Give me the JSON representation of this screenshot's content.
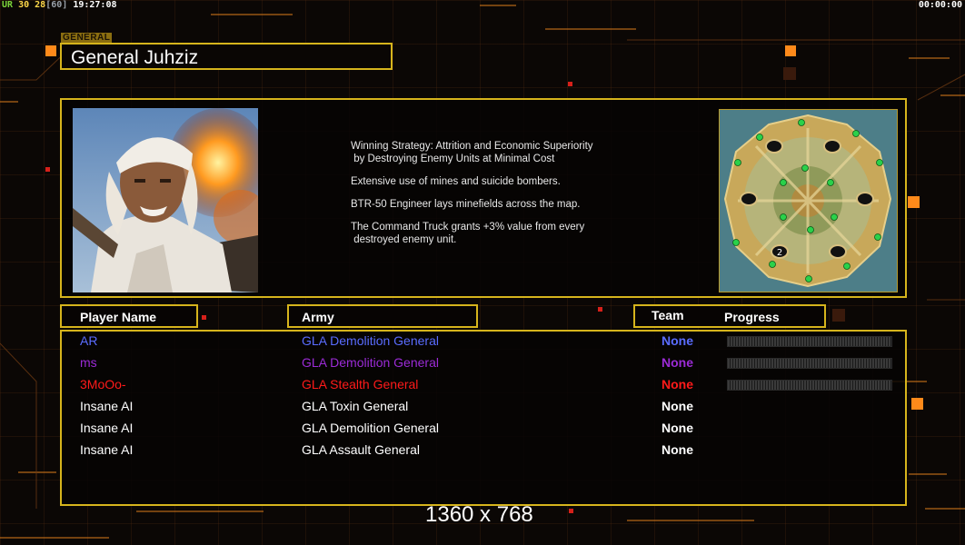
{
  "hud": {
    "ur_label": "UR",
    "value_a": "30",
    "value_b": "28",
    "fps": "[60]",
    "clock": "19:27:08",
    "timer": "00:00:00"
  },
  "header": {
    "tag": "GENERAL",
    "title": "General Juhziz"
  },
  "info": {
    "strategy_lines": [
      "Winning Strategy: Attrition and Economic Superiority\n by Destroying Enemy Units at Minimal Cost",
      "Extensive use of mines and suicide bombers.",
      "BTR-50 Engineer lays minefields across the map.",
      "The Command Truck grants +3% value from every\n destroyed enemy unit."
    ]
  },
  "columns": {
    "player": "Player Name",
    "army": "Army",
    "team": "Team",
    "progress": "Progress"
  },
  "players": [
    {
      "name": "AR",
      "army": "GLA Demolition General",
      "team": "None",
      "color": "#5a6cff",
      "progress": 0
    },
    {
      "name": "ms",
      "army": "GLA Demolition General",
      "team": "None",
      "color": "#9b2bd6",
      "progress": 0
    },
    {
      "name": "3MoOo-",
      "army": "GLA Stealth General",
      "team": "None",
      "color": "#ff1a1a",
      "progress": 0
    },
    {
      "name": "Insane AI",
      "army": "GLA Toxin General",
      "team": "None",
      "color": "#ffffff"
    },
    {
      "name": "Insane AI",
      "army": "GLA Demolition General",
      "team": "None",
      "color": "#ffffff"
    },
    {
      "name": "Insane AI",
      "army": "GLA Assault General",
      "team": "None",
      "color": "#ffffff"
    }
  ],
  "map_marker": "2",
  "resolution": "1360 x 768",
  "colors": {
    "frame": "#d6b41c",
    "accent": "#ff8a1a"
  }
}
